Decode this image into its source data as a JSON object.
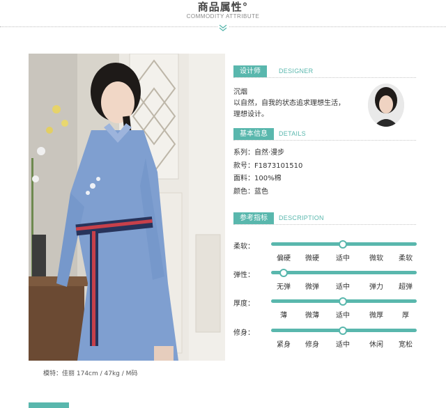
{
  "header": {
    "title": "商品属性°",
    "subtitle": "COMMODITY ATTRIBUTE"
  },
  "photo": {
    "caption": "模特：佳丽   174cm / 47kg / M码"
  },
  "designer": {
    "label": "设计师",
    "label_en": "DESIGNER",
    "name": "沉烟",
    "motto_line1": "以自然，自我的状态追求理想生活，",
    "motto_line2": "理想设计。"
  },
  "details": {
    "label": "基本信息",
    "label_en": "DETAILS",
    "rows": [
      "系列：自然·漫步",
      "款号：F1873101510",
      "面料：100%棉",
      "颜色：蓝色"
    ]
  },
  "description": {
    "label": "参考指标",
    "label_en": "DESCRIPTION",
    "scales": [
      {
        "name": "柔软：",
        "options": [
          "偏硬",
          "微硬",
          "适中",
          "微软",
          "柔软"
        ],
        "selected_index": 2
      },
      {
        "name": "弹性：",
        "options": [
          "无弹",
          "微弹",
          "适中",
          "弹力",
          "超弹"
        ],
        "selected_index": 0
      },
      {
        "name": "厚度：",
        "options": [
          "薄",
          "微薄",
          "适中",
          "微厚",
          "厚"
        ],
        "selected_index": 2
      },
      {
        "name": "修身：",
        "options": [
          "紧身",
          "修身",
          "适中",
          "休闲",
          "宽松"
        ],
        "selected_index": 2
      }
    ]
  },
  "colors": {
    "accent": "#59b7ad"
  }
}
